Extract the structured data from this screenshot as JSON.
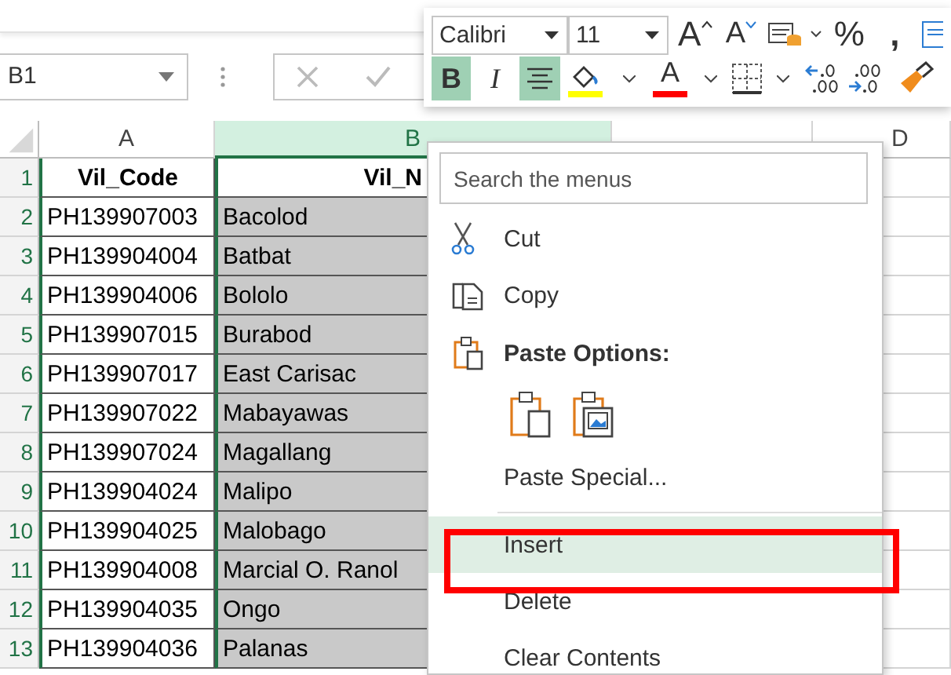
{
  "formula_bar": {
    "name_box": "B1"
  },
  "mini_toolbar": {
    "font": "Calibri",
    "size": "11",
    "row1": [
      {
        "kind": "grow_font",
        "label": "A"
      },
      {
        "kind": "shrink_font",
        "label": "A"
      },
      {
        "kind": "number_format"
      },
      {
        "kind": "symbol",
        "label": "%"
      },
      {
        "kind": "symbol",
        "label": ","
      },
      {
        "kind": "edge"
      }
    ],
    "row2": [
      {
        "kind": "bold",
        "label": "B",
        "selected": true
      },
      {
        "kind": "italic",
        "label": "I",
        "selected": false
      },
      {
        "kind": "align_center",
        "selected": true
      },
      {
        "kind": "fill_color",
        "color": "#ffff00"
      },
      {
        "kind": "font_color",
        "label": "A",
        "color": "#ff0000"
      },
      {
        "kind": "borders"
      },
      {
        "kind": "increase_decimal"
      },
      {
        "kind": "decrease_decimal"
      },
      {
        "kind": "format_painter"
      }
    ]
  },
  "sheet": {
    "columns": [
      {
        "label": "A",
        "selected": false
      },
      {
        "label": "B",
        "selected": true
      },
      {
        "selected": false
      },
      {
        "label": "D",
        "selected": false
      }
    ],
    "rows": [
      {
        "number": "1",
        "kind": "header",
        "cells": [
          "Vil_Code",
          "Vil_N"
        ]
      },
      {
        "number": "2",
        "kind": "data",
        "cells": [
          "PH139907003",
          "Bacolod"
        ]
      },
      {
        "number": "3",
        "kind": "data",
        "cells": [
          "PH139904004",
          "Batbat"
        ]
      },
      {
        "number": "4",
        "kind": "data",
        "cells": [
          "PH139904006",
          "Bololo"
        ]
      },
      {
        "number": "5",
        "kind": "data",
        "cells": [
          "PH139907015",
          "Burabod"
        ]
      },
      {
        "number": "6",
        "kind": "data",
        "cells": [
          "PH139907017",
          "East Carisac"
        ]
      },
      {
        "number": "7",
        "kind": "data",
        "cells": [
          "PH139907022",
          "Mabayawas"
        ]
      },
      {
        "number": "8",
        "kind": "data",
        "cells": [
          "PH139907024",
          "Magallang"
        ]
      },
      {
        "number": "9",
        "kind": "data",
        "cells": [
          "PH139904024",
          "Malipo"
        ]
      },
      {
        "number": "10",
        "kind": "data",
        "cells": [
          "PH139904025",
          "Malobago"
        ]
      },
      {
        "number": "11",
        "kind": "data",
        "cells": [
          "PH139904008",
          "Marcial O. Ranol"
        ]
      },
      {
        "number": "12",
        "kind": "data",
        "cells": [
          "PH139904035",
          "Ongo"
        ]
      },
      {
        "number": "13",
        "kind": "data",
        "cells": [
          "PH139904036",
          "Palanas"
        ]
      }
    ]
  },
  "context_menu": {
    "search": {
      "placeholder": "Search the menus"
    },
    "items": [
      {
        "kind": "item",
        "label": "Cut",
        "selected": false
      },
      {
        "kind": "item",
        "label": "Copy",
        "selected": false
      },
      {
        "kind": "heading",
        "label": "Paste Options:"
      },
      {
        "kind": "paste_icons"
      },
      {
        "kind": "item",
        "label": "Paste Special...",
        "selected": false
      },
      {
        "kind": "separator"
      },
      {
        "kind": "item",
        "label": "Insert",
        "selected": true
      },
      {
        "kind": "item",
        "label": "Delete",
        "selected": false
      },
      {
        "kind": "item",
        "label": "Clear Contents",
        "selected": false
      }
    ]
  },
  "annotation": {
    "kind": "rectangle"
  }
}
